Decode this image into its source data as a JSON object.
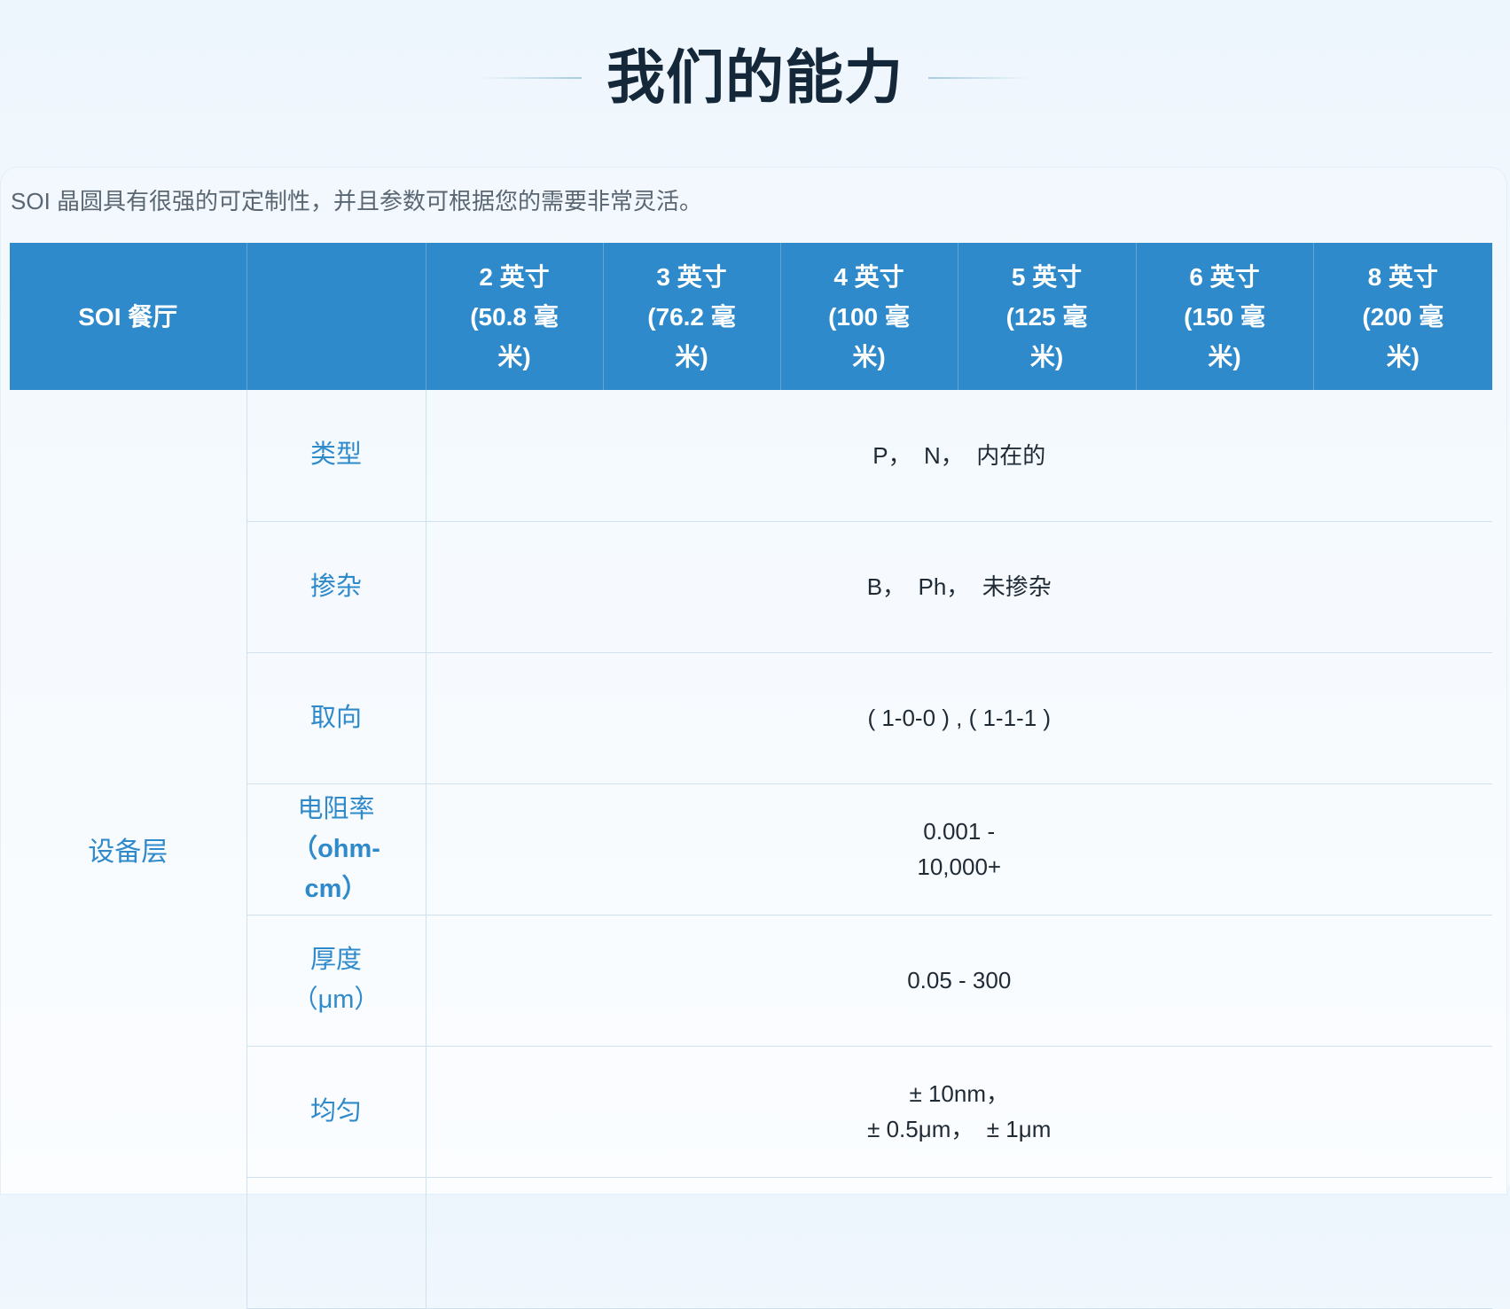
{
  "page": {
    "title": "我们的能力",
    "intro": "SOI 晶圆具有很强的可定制性，并且参数可根据您的需要非常灵活。"
  },
  "table": {
    "headers": [
      {
        "l1": "SOI 餐厅",
        "l2": "",
        "l3": ""
      },
      {
        "l1": "",
        "l2": "",
        "l3": ""
      },
      {
        "l1": "2 英寸",
        "l2": "(50.8 毫",
        "l3": "米)"
      },
      {
        "l1": "3 英寸",
        "l2": "(76.2 毫",
        "l3": "米)"
      },
      {
        "l1": "4 英寸",
        "l2": "(100 毫",
        "l3": "米)"
      },
      {
        "l1": "5 英寸",
        "l2": "(125 毫",
        "l3": "米)"
      },
      {
        "l1": "6 英寸",
        "l2": "(150 毫",
        "l3": "米)"
      },
      {
        "l1": "8 英寸",
        "l2": "(200 毫",
        "l3": "米)"
      }
    ],
    "group_label": "设备层",
    "rows": [
      {
        "param_l1": "类型",
        "param_l2": "",
        "param_l3": "",
        "value_l1": "P，  N，  内在的",
        "value_l2": ""
      },
      {
        "param_l1": "掺杂",
        "param_l2": "",
        "param_l3": "",
        "value_l1": "B，  Ph，  未掺杂",
        "value_l2": ""
      },
      {
        "param_l1": "取向",
        "param_l2": "",
        "param_l3": "",
        "value_l1": "( 1-0-0 ) , ( 1-1-1 )",
        "value_l2": ""
      },
      {
        "param_l1": "电阻率",
        "param_l2": "（ohm-",
        "param_l3": "cm）",
        "value_l1": "0.001 -",
        "value_l2": "10,000+"
      },
      {
        "param_l1": "厚度",
        "param_l2": "（μm）",
        "param_l3": "",
        "value_l1": "0.05 - 300",
        "value_l2": ""
      },
      {
        "param_l1": "均匀",
        "param_l2": "",
        "param_l3": "",
        "value_l1": "± 10nm，",
        "value_l2": "± 0.5μm，  ± 1μm"
      }
    ]
  }
}
